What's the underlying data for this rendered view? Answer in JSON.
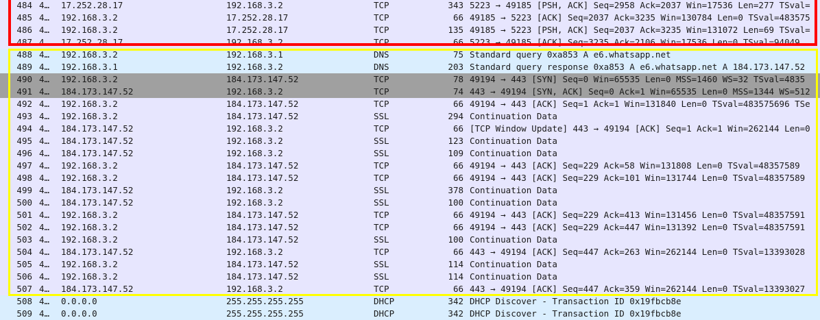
{
  "colors": {
    "tcp": "#e7e6fe",
    "dns": "#daeefe",
    "selected": "#a0a0a0",
    "highlight_red": "#ff0000",
    "highlight_yellow": "#ffff00"
  },
  "packets": [
    {
      "no": "484",
      "time": "4…",
      "src": "17.252.28.17",
      "dst": "192.168.3.2",
      "proto": "TCP",
      "len": "343",
      "info": "5223 → 49185 [PSH, ACK] Seq=2958 Ack=2037 Win=17536 Len=277 TSval=",
      "style": "tcp"
    },
    {
      "no": "485",
      "time": "4…",
      "src": "192.168.3.2",
      "dst": "17.252.28.17",
      "proto": "TCP",
      "len": "66",
      "info": "49185 → 5223 [ACK] Seq=2037 Ack=3235 Win=130784 Len=0 TSval=483575",
      "style": "tcp"
    },
    {
      "no": "486",
      "time": "4…",
      "src": "192.168.3.2",
      "dst": "17.252.28.17",
      "proto": "TCP",
      "len": "135",
      "info": "49185 → 5223 [PSH, ACK] Seq=2037 Ack=3235 Win=131072 Len=69 TSval=",
      "style": "tcp"
    },
    {
      "no": "487",
      "time": "4…",
      "src": "17.252.28.17",
      "dst": "192.168.3.2",
      "proto": "TCP",
      "len": "66",
      "info": "5223 → 49185 [ACK] Seq=3235 Ack=2106 Win=17536 Len=0 TSval=94049",
      "style": "tcp"
    },
    {
      "no": "488",
      "time": "4…",
      "src": "192.168.3.2",
      "dst": "192.168.3.1",
      "proto": "DNS",
      "len": "75",
      "info": "Standard query 0xa853 A e6.whatsapp.net",
      "style": "dns"
    },
    {
      "no": "489",
      "time": "4…",
      "src": "192.168.3.1",
      "dst": "192.168.3.2",
      "proto": "DNS",
      "len": "203",
      "info": "Standard query response 0xa853 A e6.whatsapp.net A 184.173.147.52",
      "style": "dns"
    },
    {
      "no": "490",
      "time": "4…",
      "src": "192.168.3.2",
      "dst": "184.173.147.52",
      "proto": "TCP",
      "len": "78",
      "info": "49194 → 443 [SYN] Seq=0 Win=65535 Len=0 MSS=1460 WS=32 TSval=4835",
      "style": "sel"
    },
    {
      "no": "491",
      "time": "4…",
      "src": "184.173.147.52",
      "dst": "192.168.3.2",
      "proto": "TCP",
      "len": "74",
      "info": "443 → 49194 [SYN, ACK] Seq=0 Ack=1 Win=65535 Len=0 MSS=1344 WS=512",
      "style": "sel"
    },
    {
      "no": "492",
      "time": "4…",
      "src": "192.168.3.2",
      "dst": "184.173.147.52",
      "proto": "TCP",
      "len": "66",
      "info": "49194 → 443 [ACK] Seq=1 Ack=1 Win=131840 Len=0 TSval=483575696 TSe",
      "style": "tcp"
    },
    {
      "no": "493",
      "time": "4…",
      "src": "192.168.3.2",
      "dst": "184.173.147.52",
      "proto": "SSL",
      "len": "294",
      "info": "Continuation Data",
      "style": "tcp"
    },
    {
      "no": "494",
      "time": "4…",
      "src": "184.173.147.52",
      "dst": "192.168.3.2",
      "proto": "TCP",
      "len": "66",
      "info": "[TCP Window Update] 443 → 49194 [ACK] Seq=1 Ack=1 Win=262144 Len=0",
      "style": "tcp"
    },
    {
      "no": "495",
      "time": "4…",
      "src": "184.173.147.52",
      "dst": "192.168.3.2",
      "proto": "SSL",
      "len": "123",
      "info": "Continuation Data",
      "style": "tcp"
    },
    {
      "no": "496",
      "time": "4…",
      "src": "184.173.147.52",
      "dst": "192.168.3.2",
      "proto": "SSL",
      "len": "109",
      "info": "Continuation Data",
      "style": "tcp"
    },
    {
      "no": "497",
      "time": "4…",
      "src": "192.168.3.2",
      "dst": "184.173.147.52",
      "proto": "TCP",
      "len": "66",
      "info": "49194 → 443 [ACK] Seq=229 Ack=58 Win=131808 Len=0 TSval=48357589",
      "style": "tcp"
    },
    {
      "no": "498",
      "time": "4…",
      "src": "192.168.3.2",
      "dst": "184.173.147.52",
      "proto": "TCP",
      "len": "66",
      "info": "49194 → 443 [ACK] Seq=229 Ack=101 Win=131744 Len=0 TSval=48357589",
      "style": "tcp"
    },
    {
      "no": "499",
      "time": "4…",
      "src": "184.173.147.52",
      "dst": "192.168.3.2",
      "proto": "SSL",
      "len": "378",
      "info": "Continuation Data",
      "style": "tcp"
    },
    {
      "no": "500",
      "time": "4…",
      "src": "184.173.147.52",
      "dst": "192.168.3.2",
      "proto": "SSL",
      "len": "100",
      "info": "Continuation Data",
      "style": "tcp"
    },
    {
      "no": "501",
      "time": "4…",
      "src": "192.168.3.2",
      "dst": "184.173.147.52",
      "proto": "TCP",
      "len": "66",
      "info": "49194 → 443 [ACK] Seq=229 Ack=413 Win=131456 Len=0 TSval=48357591",
      "style": "tcp"
    },
    {
      "no": "502",
      "time": "4…",
      "src": "192.168.3.2",
      "dst": "184.173.147.52",
      "proto": "TCP",
      "len": "66",
      "info": "49194 → 443 [ACK] Seq=229 Ack=447 Win=131392 Len=0 TSval=48357591",
      "style": "tcp"
    },
    {
      "no": "503",
      "time": "4…",
      "src": "192.168.3.2",
      "dst": "184.173.147.52",
      "proto": "SSL",
      "len": "100",
      "info": "Continuation Data",
      "style": "tcp"
    },
    {
      "no": "504",
      "time": "4…",
      "src": "184.173.147.52",
      "dst": "192.168.3.2",
      "proto": "TCP",
      "len": "66",
      "info": "443 → 49194 [ACK] Seq=447 Ack=263 Win=262144 Len=0 TSval=13393028",
      "style": "tcp"
    },
    {
      "no": "505",
      "time": "4…",
      "src": "192.168.3.2",
      "dst": "184.173.147.52",
      "proto": "SSL",
      "len": "114",
      "info": "Continuation Data",
      "style": "tcp"
    },
    {
      "no": "506",
      "time": "4…",
      "src": "192.168.3.2",
      "dst": "184.173.147.52",
      "proto": "SSL",
      "len": "114",
      "info": "Continuation Data",
      "style": "tcp"
    },
    {
      "no": "507",
      "time": "4…",
      "src": "184.173.147.52",
      "dst": "192.168.3.2",
      "proto": "TCP",
      "len": "66",
      "info": "443 → 49194 [ACK] Seq=447 Ack=359 Win=262144 Len=0 TSval=13393027",
      "style": "tcp"
    },
    {
      "no": "508",
      "time": "4…",
      "src": "0.0.0.0",
      "dst": "255.255.255.255",
      "proto": "DHCP",
      "len": "342",
      "info": "DHCP Discover - Transaction ID 0x19fbcb8e",
      "style": "dns"
    },
    {
      "no": "509",
      "time": "4…",
      "src": "0.0.0.0",
      "dst": "255.255.255.255",
      "proto": "DHCP",
      "len": "342",
      "info": "DHCP Discover - Transaction ID 0x19fbcb8e",
      "style": "dns"
    }
  ]
}
